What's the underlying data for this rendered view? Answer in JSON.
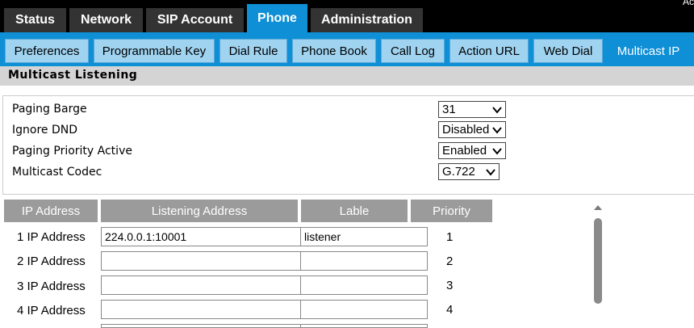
{
  "header": {
    "corner_text": "Ac"
  },
  "main_tabs": [
    {
      "label": "Status"
    },
    {
      "label": "Network"
    },
    {
      "label": "SIP Account"
    },
    {
      "label": "Phone",
      "active": true
    },
    {
      "label": "Administration"
    }
  ],
  "sub_tabs": [
    {
      "label": "Preferences"
    },
    {
      "label": "Programmable Key"
    },
    {
      "label": "Dial Rule"
    },
    {
      "label": "Phone Book"
    },
    {
      "label": "Call Log"
    },
    {
      "label": "Action URL"
    },
    {
      "label": "Web Dial"
    },
    {
      "label": "Multicast IP",
      "active": true
    }
  ],
  "section": {
    "title": "Multicast Listening"
  },
  "settings": [
    {
      "label": "Paging Barge",
      "value": "31"
    },
    {
      "label": "Ignore DND",
      "value": "Disabled"
    },
    {
      "label": "Paging Priority Active",
      "value": "Enabled"
    },
    {
      "label": "Multicast Codec",
      "value": "G.722"
    }
  ],
  "table": {
    "headers": [
      "IP Address",
      "Listening Address",
      "Lable",
      "Priority"
    ],
    "rows": [
      {
        "label": "1 IP Address",
        "address": "224.0.0.1:10001",
        "lable": "listener",
        "priority": "1"
      },
      {
        "label": "2 IP Address",
        "address": "",
        "lable": "",
        "priority": "2"
      },
      {
        "label": "3 IP Address",
        "address": "",
        "lable": "",
        "priority": "3"
      },
      {
        "label": "4 IP Address",
        "address": "",
        "lable": "",
        "priority": "4"
      }
    ]
  },
  "colors": {
    "accent": "#0e8fd6",
    "tab_dark": "#333333",
    "subtab": "#9fd3f0",
    "table_header": "#9b9b9b",
    "section_bar": "#d4d4d4"
  }
}
